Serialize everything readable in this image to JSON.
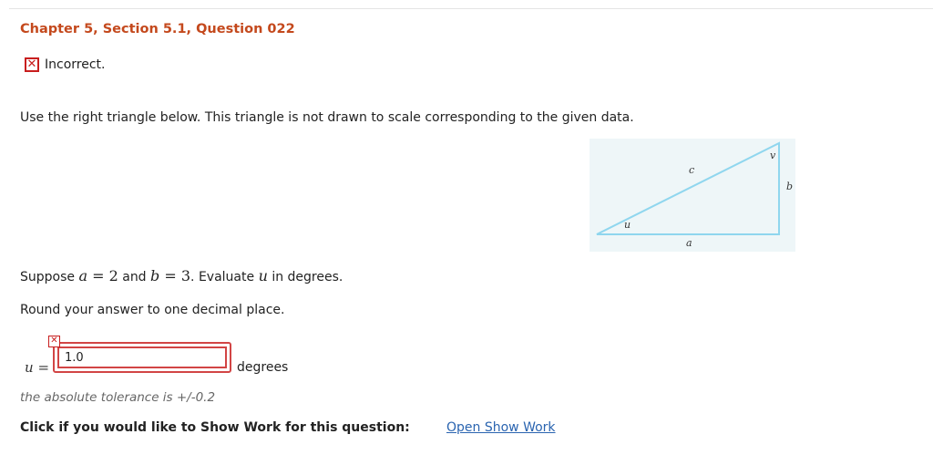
{
  "title": "Chapter 5, Section 5.1, Question 022",
  "status": {
    "icon": "incorrect-x-icon",
    "text": "Incorrect."
  },
  "instruction": "Use the right triangle below. This triangle is not drawn to scale corresponding to the given data.",
  "figure": {
    "labels": {
      "u": "u",
      "v": "v",
      "a": "a",
      "b": "b",
      "c": "c"
    }
  },
  "question": {
    "prefix": "Suppose",
    "var_a": "a",
    "eq_a": " = 2",
    "and_text": "and",
    "var_b": "b",
    "eq_b": " = 3",
    "evaluate": ". Evaluate",
    "var_u": "u",
    "suffix": "in degrees."
  },
  "round_instruction": "Round your answer to one decimal place.",
  "answer": {
    "label_var": "u",
    "label_eq": " =",
    "value": "1.0",
    "units": "degrees",
    "status": "incorrect"
  },
  "tolerance": "the absolute tolerance is +/-0.2",
  "show_work": {
    "prompt": "Click if you would like to Show Work for this question:",
    "link_text": "Open Show Work"
  },
  "colors": {
    "title": "#c4491d",
    "incorrect": "#c81e1e",
    "link": "#2a64b0",
    "triangle": "#8fd6ee"
  }
}
